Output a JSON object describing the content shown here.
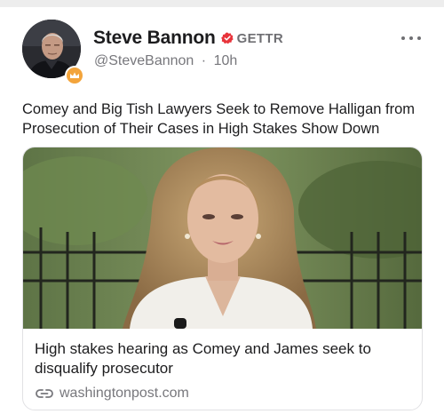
{
  "author": {
    "display_name": "Steve Bannon",
    "platform_label": "GETTR",
    "handle": "@SteveBannon",
    "separator": "·",
    "time_ago": "10h"
  },
  "post": {
    "text": "Comey and Big Tish Lawyers Seek to Remove Halligan from Prosecution of Their Cases in High Stakes Show Down"
  },
  "link_preview": {
    "title": "High stakes hearing as Comey and James seek to disqualify prosecutor",
    "domain": "washingtonpost.com"
  },
  "colors": {
    "verified_badge": "#e8343b",
    "avatar_badge": "#f3a43b",
    "muted_text": "#77777c"
  },
  "icons": {
    "verified": "verified-badge-icon",
    "more": "more-options-icon",
    "link": "link-icon",
    "avatar_badge": "crown-badge-icon"
  }
}
